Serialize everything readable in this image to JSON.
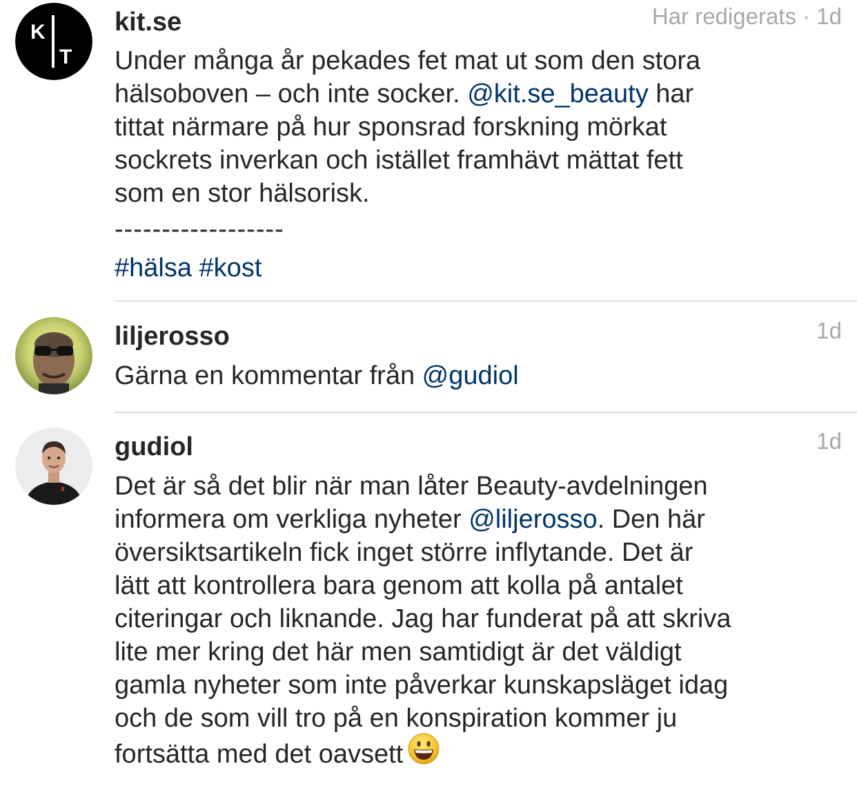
{
  "comments": [
    {
      "username": "kit.se",
      "meta": "Har redigerats · 1d",
      "avatar": "kit-logo-avatar",
      "lines": [
        {
          "parts": [
            "Under många år pekades fet mat ut som den stora"
          ]
        },
        {
          "parts": [
            "hälsoboven – och inte socker. ",
            "@kit.se_beauty",
            " har"
          ]
        },
        {
          "parts": [
            "tittat närmare på hur sponsrad forskning mörkat"
          ]
        },
        {
          "parts": [
            "sockrets inverkan och istället framhävt mättat fett"
          ]
        },
        {
          "parts": [
            "som en stor hälsorisk."
          ]
        }
      ],
      "separator": "------------------",
      "hashtags": [
        "#hälsa",
        "#kost"
      ]
    },
    {
      "username": "liljerosso",
      "meta": "1d",
      "avatar": "user-photo-avatar",
      "text_before": "Gärna en kommentar från ",
      "mention": "@gudiol",
      "text_after": ""
    },
    {
      "username": "gudiol",
      "meta": "1d",
      "avatar": "user-photo-avatar",
      "lines": [
        {
          "parts": [
            "Det är så det blir när man låter Beauty-avdelningen"
          ]
        },
        {
          "parts": [
            "informera om verkliga nyheter ",
            "@liljerosso",
            ". Den här"
          ]
        },
        {
          "parts": [
            "översiktsartikeln fick inget större inflytande. Det är"
          ]
        },
        {
          "parts": [
            "lätt att kontrollera bara genom att kolla på antalet"
          ]
        },
        {
          "parts": [
            "citeringar och liknande. Jag har funderat på att skriva"
          ]
        },
        {
          "parts": [
            "lite mer kring det här men samtidigt är det väldigt"
          ]
        },
        {
          "parts": [
            "gamla nyheter som inte påverkar kunskapsläget idag"
          ]
        },
        {
          "parts": [
            "och de som vill tro på en konspiration kommer ju"
          ]
        },
        {
          "parts": [
            "fortsätta med det oavsett"
          ]
        }
      ],
      "trailing_emoji": "grinning-face-emoji"
    }
  ],
  "colors": {
    "text": "#262626",
    "link": "#003569",
    "meta": "#a8a8a8",
    "divider": "#dbdbdb"
  }
}
